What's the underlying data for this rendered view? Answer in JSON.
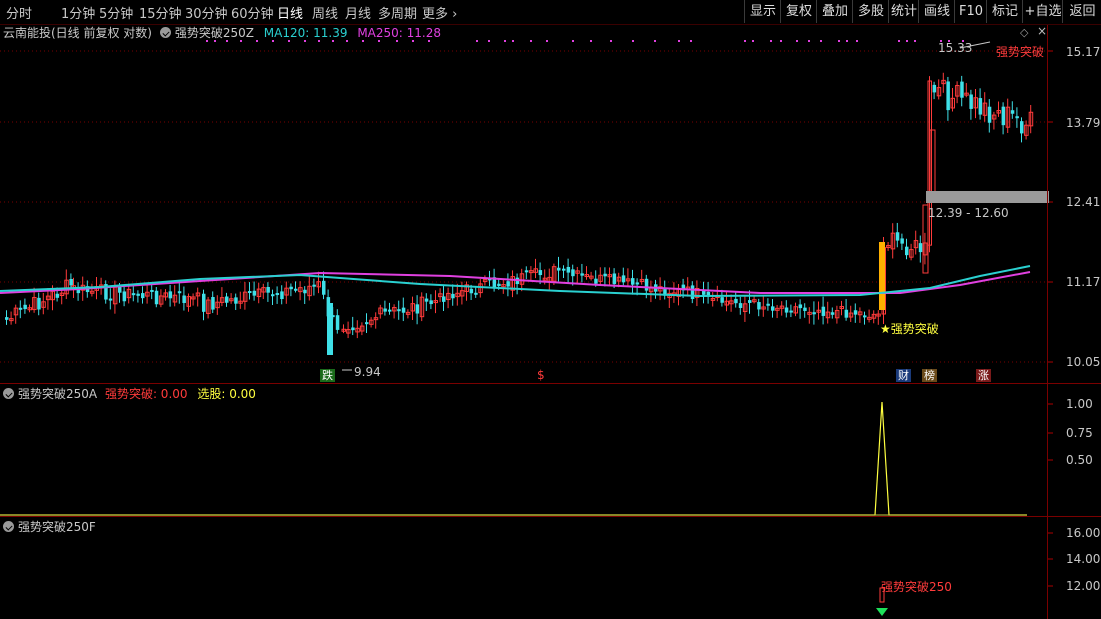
{
  "toolbar": {
    "periods": [
      "分时",
      "1分钟",
      "5分钟",
      "15分钟",
      "30分钟",
      "60分钟",
      "日线",
      "周线",
      "月线",
      "多周期",
      "更多"
    ],
    "active_period": "日线",
    "right_buttons": [
      "显示",
      "复权",
      "叠加",
      "多股",
      "统计",
      "画线",
      "F10",
      "标记",
      "+自选",
      "返回"
    ]
  },
  "main_pane": {
    "title": "云南能投(日线 前复权 对数)",
    "indicator_name": "强势突破250Z",
    "ma120_label": "MA120: 11.39",
    "ma250_label": "MA250: 11.28",
    "y_ticks": [
      "15.17",
      "13.79",
      "12.41",
      "11.17",
      "10.05"
    ],
    "high_label": "15.33",
    "low_label": "9.94",
    "zone_label": "12.39 - 12.60",
    "signal_label": "★强势突破",
    "signal_label_top": "强势突破",
    "badges": {
      "die": "跌",
      "dollar": "$",
      "cai": "财",
      "bang": "榜",
      "zhang": "涨"
    },
    "colors": {
      "ma120": "#2ad0d0",
      "ma250": "#e040e0",
      "up": "#ff3b3b",
      "down": "#3fe0e8"
    }
  },
  "sub_pane_a": {
    "name": "强势突破250A",
    "signal_text": "强势突破: 0.00",
    "select_text": "选股: 0.00",
    "y_ticks": [
      "1.00",
      "0.75",
      "0.50"
    ]
  },
  "sub_pane_f": {
    "name": "强势突破250F",
    "y_ticks": [
      "16.00",
      "14.00",
      "12.00"
    ],
    "signal_label": "强势突破250"
  },
  "chart_data": {
    "type": "candlestick",
    "title": "云南能投(日线 前复权 对数)",
    "ylim": [
      9.94,
      15.33
    ],
    "y_ticks": [
      15.17,
      13.79,
      12.41,
      11.17,
      10.05
    ],
    "note_high": 15.33,
    "note_low": 9.94,
    "series": [
      {
        "name": "MA120",
        "last": 11.39
      },
      {
        "name": "MA250",
        "last": 11.28
      }
    ],
    "signal_series": {
      "name": "强势突破",
      "values_peak": 1.0
    }
  }
}
